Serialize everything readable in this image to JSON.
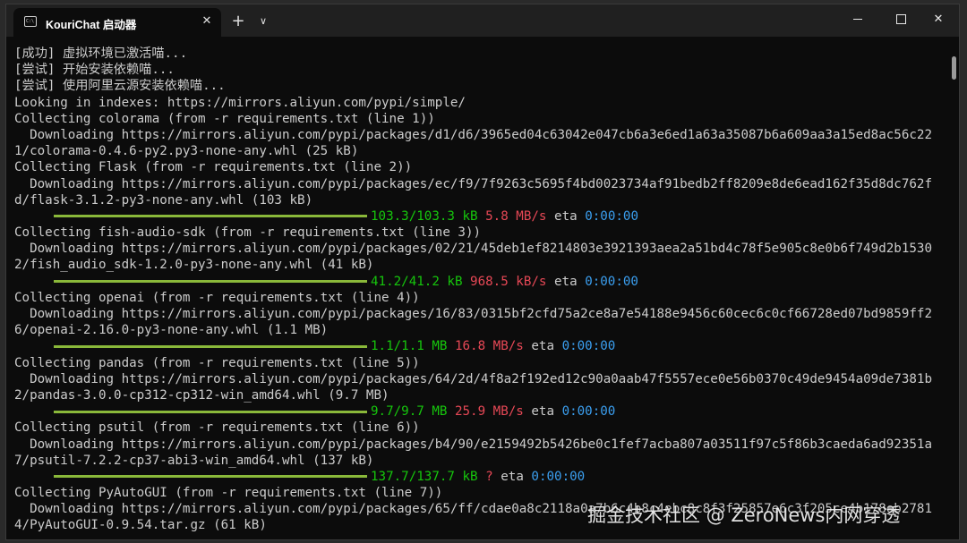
{
  "window": {
    "tab_title": "KouriChat 启动器",
    "tab_icon": "terminal-icon",
    "tab_close_glyph": "✕",
    "new_tab_glyph": "+",
    "dropdown_glyph": "∨",
    "close_glyph": "✕"
  },
  "console": {
    "lines": [
      {
        "text": "[成功] 虚拟环境已激活喵..."
      },
      {
        "text": "[尝试] 开始安装依赖喵..."
      },
      {
        "text": "[尝试] 使用阿里云源安装依赖喵..."
      },
      {
        "text": "Looking in indexes: https://mirrors.aliyun.com/pypi/simple/"
      },
      {
        "text": "Collecting colorama (from -r requirements.txt (line 1))"
      },
      {
        "text": "  Downloading https://mirrors.aliyun.com/pypi/packages/d1/d6/3965ed04c63042e047cb6a3e6ed1a63a35087b6a609aa3a15ed8ac56c22"
      },
      {
        "text": "1/colorama-0.4.6-py2.py3-none-any.whl (25 kB)"
      },
      {
        "text": "Collecting Flask (from -r requirements.txt (line 2))"
      },
      {
        "text": "  Downloading https://mirrors.aliyun.com/pypi/packages/ec/f9/7f9263c5695f4bd0023734af91bedb2ff8209e8de6ead162f35d8dc762f"
      },
      {
        "text": "d/flask-3.1.2-py3-none-any.whl (103 kB)"
      },
      {
        "progress": {
          "size": "103.3/103.3 kB",
          "speed": "5.8 MB/s",
          "eta_label": "eta",
          "eta": "0:00:00",
          "fraction": 1.0
        }
      },
      {
        "text": "Collecting fish-audio-sdk (from -r requirements.txt (line 3))"
      },
      {
        "text": "  Downloading https://mirrors.aliyun.com/pypi/packages/02/21/45deb1ef8214803e3921393aea2a51bd4c78f5e905c8e0b6f749d2b1530"
      },
      {
        "text": "2/fish_audio_sdk-1.2.0-py3-none-any.whl (41 kB)"
      },
      {
        "progress": {
          "size": "41.2/41.2 kB",
          "speed": "968.5 kB/s",
          "eta_label": "eta",
          "eta": "0:00:00",
          "fraction": 1.0
        }
      },
      {
        "text": "Collecting openai (from -r requirements.txt (line 4))"
      },
      {
        "text": "  Downloading https://mirrors.aliyun.com/pypi/packages/16/83/0315bf2cfd75a2ce8a7e54188e9456c60cec6c0cf66728ed07bd9859ff2"
      },
      {
        "text": "6/openai-2.16.0-py3-none-any.whl (1.1 MB)"
      },
      {
        "progress": {
          "size": "1.1/1.1 MB",
          "speed": "16.8 MB/s",
          "eta_label": "eta",
          "eta": "0:00:00",
          "fraction": 1.0
        }
      },
      {
        "text": "Collecting pandas (from -r requirements.txt (line 5))"
      },
      {
        "text": "  Downloading https://mirrors.aliyun.com/pypi/packages/64/2d/4f8a2f192ed12c90a0aab47f5557ece0e56b0370c49de9454a09de7381b"
      },
      {
        "text": "2/pandas-3.0.0-cp312-cp312-win_amd64.whl (9.7 MB)"
      },
      {
        "progress": {
          "size": "9.7/9.7 MB",
          "speed": "25.9 MB/s",
          "eta_label": "eta",
          "eta": "0:00:00",
          "fraction": 1.0
        }
      },
      {
        "text": "Collecting psutil (from -r requirements.txt (line 6))"
      },
      {
        "text": "  Downloading https://mirrors.aliyun.com/pypi/packages/b4/90/e2159492b5426be0c1fef7acba807a03511f97c5f86b3caeda6ad92351a"
      },
      {
        "text": "7/psutil-7.2.2-cp37-abi3-win_amd64.whl (137 kB)"
      },
      {
        "progress": {
          "size": "137.7/137.7 kB",
          "speed": "?",
          "eta_label": "eta",
          "eta": "0:00:00",
          "fraction": 1.0
        }
      },
      {
        "text": "Collecting PyAutoGUI (from -r requirements.txt (line 7))"
      },
      {
        "text": "  Downloading https://mirrors.aliyun.com/pypi/packages/65/ff/cdae0a8c2118a0a7b6c4b8c4ebc8c8f3f25857e6c3f205ce4b178eb2781"
      },
      {
        "text": "4/PyAutoGUI-0.9.54.tar.gz (61 kB)"
      }
    ]
  },
  "watermark": "掘金技术社区 @ ZeroNews内网穿透",
  "colors": {
    "background": "#0c0c0c",
    "text": "#cccccc",
    "bar": "#8ab83a",
    "size": "#16c60c",
    "speed": "#e74856",
    "eta": "#3b9ff0"
  }
}
